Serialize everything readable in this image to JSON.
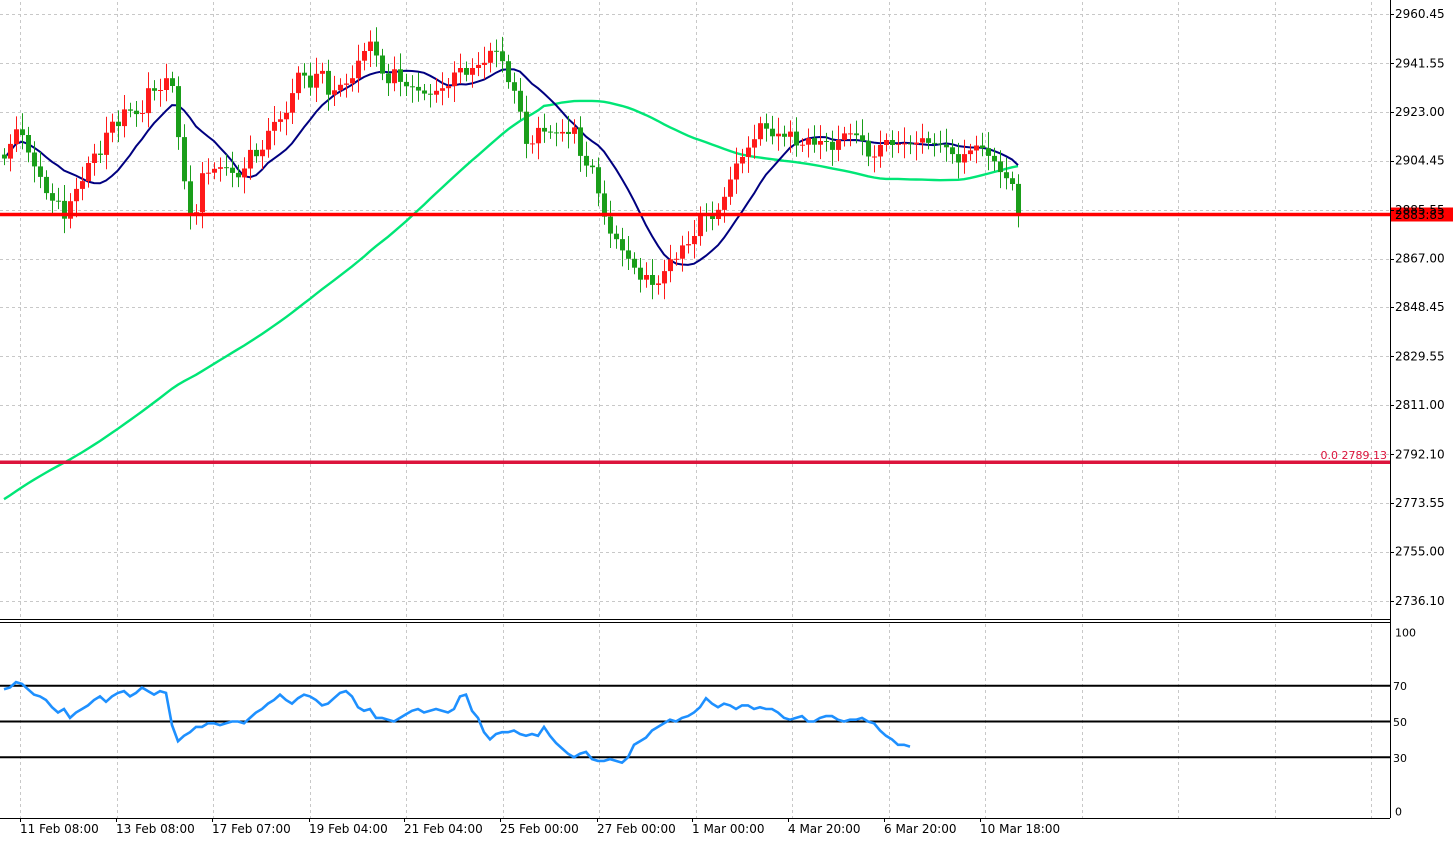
{
  "chart_data": [
    {
      "type": "candlestick",
      "title": "",
      "grid": true,
      "ylim": [
        2726.8,
        2965.1
      ],
      "y_ticks": [
        "2960.45",
        "2941.55",
        "2923.00",
        "2904.45",
        "2885.55",
        "2867.00",
        "2848.45",
        "2829.55",
        "2811.00",
        "2792.10",
        "2773.55",
        "2755.00",
        "2736.10"
      ],
      "x_ticks": [
        "11 Feb 08:00",
        "13 Feb 08:00",
        "17 Feb 07:00",
        "19 Feb 04:00",
        "21 Feb 04:00",
        "25 Feb 00:00",
        "27 Feb 00:00",
        "1 Mar 00:00",
        "4 Mar 20:00",
        "6 Mar 20:00",
        "10 Mar 18:00"
      ],
      "bars_visible": 170,
      "price_line": {
        "value": 2883.83,
        "label": "2883.83",
        "color": "#ff0000"
      },
      "fib_line": {
        "value": 2789.13,
        "label": "0.0 2789.13",
        "color": "#dc143c"
      },
      "close": [
        2905.2,
        2910.8,
        2916.4,
        2914.2,
        2907.5,
        2902.2,
        2898.2,
        2892.0,
        2889.1,
        2889.0,
        2882.2,
        2888.9,
        2893.6,
        2896.6,
        2903.5,
        2907.1,
        2906.6,
        2915.1,
        2919.3,
        2917.6,
        2924.0,
        2923.5,
        2922.2,
        2922.6,
        2932.1,
        2931.1,
        2931.4,
        2935.9,
        2932.9,
        2913.4,
        2896.5,
        2883.6,
        2884.7,
        2899.6,
        2899.8,
        2901.3,
        2901.9,
        2901.7,
        2899.7,
        2898.0,
        2901.4,
        2908.5,
        2906.1,
        2908.6,
        2915.8,
        2919.2,
        2920.2,
        2922.7,
        2930.2,
        2938.0,
        2936.9,
        2932.3,
        2937.6,
        2938.7,
        2929.6,
        2931.3,
        2933.4,
        2933.9,
        2935.9,
        2942.6,
        2946.3,
        2949.9,
        2944.6,
        2937.7,
        2934.0,
        2939.3,
        2934.5,
        2932.8,
        2932.6,
        2931.2,
        2930.0,
        2929.6,
        2931.1,
        2932.1,
        2932.9,
        2938.1,
        2939.8,
        2937.2,
        2939.8,
        2941.0,
        2941.8,
        2946.4,
        2946.2,
        2942.4,
        2934.4,
        2931.1,
        2923.1,
        2910.8,
        2911.0,
        2916.9,
        2915.5,
        2915.2,
        2914.8,
        2915.4,
        2914.6,
        2917.1,
        2906.2,
        2902.5,
        2901.9,
        2891.9,
        2883.0,
        2876.5,
        2874.4,
        2870.1,
        2866.9,
        2863.5,
        2858.9,
        2860.7,
        2856.9,
        2857.5,
        2862.2,
        2866.7,
        2866.9,
        2872.0,
        2872.5,
        2875.6,
        2883.8,
        2883.3,
        2882.1,
        2885.6,
        2890.6,
        2897.2,
        2903.3,
        2905.8,
        2909.4,
        2912.6,
        2918.7,
        2916.6,
        2913.7,
        2914.7,
        2913.5,
        2915.5,
        2910.2,
        2910.5,
        2913.0,
        2910.5,
        2911.9,
        2911.6,
        2908.5,
        2912.3,
        2914.8,
        2914.8,
        2914.1,
        2912.0,
        2906.0,
        2906.0,
        2910.4,
        2912.3,
        2910.4,
        2910.8,
        2911.0,
        2910.6,
        2911.3,
        2913.0,
        2911.2,
        2910.9,
        2910.5,
        2909.5,
        2906.9,
        2903.7,
        2906.9,
        2908.3,
        2910.2,
        2909.2,
        2906.2,
        2904.1,
        2900.0,
        2897.7,
        2895.5,
        2883.8
      ],
      "ma_short": {
        "name": "",
        "color": "#000080"
      },
      "ma_long": {
        "name": "",
        "color": "#00e676"
      }
    },
    {
      "type": "line",
      "title": "",
      "ylim": [
        0,
        100
      ],
      "y_ticks": [
        "100",
        "0"
      ],
      "levels": [
        70,
        50,
        30
      ],
      "level_labels": [
        "70",
        "50",
        "30"
      ],
      "series": [
        {
          "color": "#1e90ff",
          "values": [
            68,
            69,
            72,
            71,
            68,
            65,
            64,
            62,
            58,
            55,
            57,
            52,
            55,
            57,
            59,
            62,
            64,
            61,
            64,
            66,
            67,
            64,
            66,
            69,
            67,
            65,
            67,
            66,
            48,
            39,
            42,
            44,
            47,
            47,
            49,
            49,
            48,
            49,
            50,
            50,
            49,
            52,
            55,
            57,
            60,
            62,
            65,
            62,
            60,
            63,
            65,
            64,
            62,
            59,
            60,
            63,
            66,
            67,
            64,
            58,
            56,
            57,
            52,
            52,
            51,
            50,
            52,
            54,
            56,
            57,
            55,
            56,
            57,
            56,
            55,
            57,
            64,
            65,
            56,
            52,
            44,
            40,
            43,
            44,
            44,
            45,
            43,
            42,
            43,
            42,
            47,
            42,
            38,
            35,
            32,
            30,
            32,
            33,
            29,
            28,
            28,
            29,
            28,
            27,
            30,
            37,
            39,
            41,
            45,
            47,
            49,
            51,
            50,
            52,
            53,
            55,
            58,
            63,
            60,
            58,
            60,
            59,
            57,
            59,
            59,
            57,
            58,
            57,
            57,
            55,
            52,
            51,
            52,
            53,
            50,
            50,
            52,
            53,
            53,
            51,
            50,
            51,
            51,
            52,
            50,
            49,
            45,
            42,
            40,
            37,
            37,
            36
          ]
        }
      ]
    }
  ]
}
